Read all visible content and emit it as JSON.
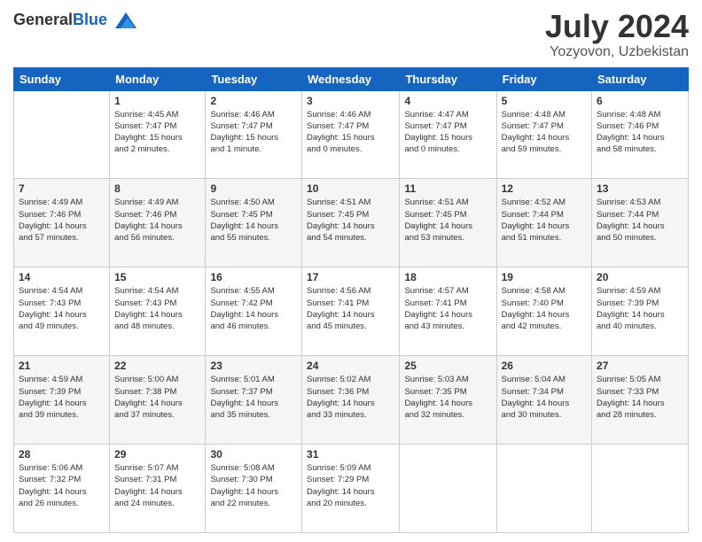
{
  "header": {
    "logo_general": "General",
    "logo_blue": "Blue",
    "month": "July 2024",
    "location": "Yozyovon, Uzbekistan"
  },
  "days_of_week": [
    "Sunday",
    "Monday",
    "Tuesday",
    "Wednesday",
    "Thursday",
    "Friday",
    "Saturday"
  ],
  "weeks": [
    [
      {
        "day": "",
        "info": ""
      },
      {
        "day": "1",
        "info": "Sunrise: 4:45 AM\nSunset: 7:47 PM\nDaylight: 15 hours\nand 2 minutes."
      },
      {
        "day": "2",
        "info": "Sunrise: 4:46 AM\nSunset: 7:47 PM\nDaylight: 15 hours\nand 1 minute."
      },
      {
        "day": "3",
        "info": "Sunrise: 4:46 AM\nSunset: 7:47 PM\nDaylight: 15 hours\nand 0 minutes."
      },
      {
        "day": "4",
        "info": "Sunrise: 4:47 AM\nSunset: 7:47 PM\nDaylight: 15 hours\nand 0 minutes."
      },
      {
        "day": "5",
        "info": "Sunrise: 4:48 AM\nSunset: 7:47 PM\nDaylight: 14 hours\nand 59 minutes."
      },
      {
        "day": "6",
        "info": "Sunrise: 4:48 AM\nSunset: 7:46 PM\nDaylight: 14 hours\nand 58 minutes."
      }
    ],
    [
      {
        "day": "7",
        "info": "Sunrise: 4:49 AM\nSunset: 7:46 PM\nDaylight: 14 hours\nand 57 minutes."
      },
      {
        "day": "8",
        "info": "Sunrise: 4:49 AM\nSunset: 7:46 PM\nDaylight: 14 hours\nand 56 minutes."
      },
      {
        "day": "9",
        "info": "Sunrise: 4:50 AM\nSunset: 7:45 PM\nDaylight: 14 hours\nand 55 minutes."
      },
      {
        "day": "10",
        "info": "Sunrise: 4:51 AM\nSunset: 7:45 PM\nDaylight: 14 hours\nand 54 minutes."
      },
      {
        "day": "11",
        "info": "Sunrise: 4:51 AM\nSunset: 7:45 PM\nDaylight: 14 hours\nand 53 minutes."
      },
      {
        "day": "12",
        "info": "Sunrise: 4:52 AM\nSunset: 7:44 PM\nDaylight: 14 hours\nand 51 minutes."
      },
      {
        "day": "13",
        "info": "Sunrise: 4:53 AM\nSunset: 7:44 PM\nDaylight: 14 hours\nand 50 minutes."
      }
    ],
    [
      {
        "day": "14",
        "info": "Sunrise: 4:54 AM\nSunset: 7:43 PM\nDaylight: 14 hours\nand 49 minutes."
      },
      {
        "day": "15",
        "info": "Sunrise: 4:54 AM\nSunset: 7:43 PM\nDaylight: 14 hours\nand 48 minutes."
      },
      {
        "day": "16",
        "info": "Sunrise: 4:55 AM\nSunset: 7:42 PM\nDaylight: 14 hours\nand 46 minutes."
      },
      {
        "day": "17",
        "info": "Sunrise: 4:56 AM\nSunset: 7:41 PM\nDaylight: 14 hours\nand 45 minutes."
      },
      {
        "day": "18",
        "info": "Sunrise: 4:57 AM\nSunset: 7:41 PM\nDaylight: 14 hours\nand 43 minutes."
      },
      {
        "day": "19",
        "info": "Sunrise: 4:58 AM\nSunset: 7:40 PM\nDaylight: 14 hours\nand 42 minutes."
      },
      {
        "day": "20",
        "info": "Sunrise: 4:59 AM\nSunset: 7:39 PM\nDaylight: 14 hours\nand 40 minutes."
      }
    ],
    [
      {
        "day": "21",
        "info": "Sunrise: 4:59 AM\nSunset: 7:39 PM\nDaylight: 14 hours\nand 39 minutes."
      },
      {
        "day": "22",
        "info": "Sunrise: 5:00 AM\nSunset: 7:38 PM\nDaylight: 14 hours\nand 37 minutes."
      },
      {
        "day": "23",
        "info": "Sunrise: 5:01 AM\nSunset: 7:37 PM\nDaylight: 14 hours\nand 35 minutes."
      },
      {
        "day": "24",
        "info": "Sunrise: 5:02 AM\nSunset: 7:36 PM\nDaylight: 14 hours\nand 33 minutes."
      },
      {
        "day": "25",
        "info": "Sunrise: 5:03 AM\nSunset: 7:35 PM\nDaylight: 14 hours\nand 32 minutes."
      },
      {
        "day": "26",
        "info": "Sunrise: 5:04 AM\nSunset: 7:34 PM\nDaylight: 14 hours\nand 30 minutes."
      },
      {
        "day": "27",
        "info": "Sunrise: 5:05 AM\nSunset: 7:33 PM\nDaylight: 14 hours\nand 28 minutes."
      }
    ],
    [
      {
        "day": "28",
        "info": "Sunrise: 5:06 AM\nSunset: 7:32 PM\nDaylight: 14 hours\nand 26 minutes."
      },
      {
        "day": "29",
        "info": "Sunrise: 5:07 AM\nSunset: 7:31 PM\nDaylight: 14 hours\nand 24 minutes."
      },
      {
        "day": "30",
        "info": "Sunrise: 5:08 AM\nSunset: 7:30 PM\nDaylight: 14 hours\nand 22 minutes."
      },
      {
        "day": "31",
        "info": "Sunrise: 5:09 AM\nSunset: 7:29 PM\nDaylight: 14 hours\nand 20 minutes."
      },
      {
        "day": "",
        "info": ""
      },
      {
        "day": "",
        "info": ""
      },
      {
        "day": "",
        "info": ""
      }
    ]
  ]
}
